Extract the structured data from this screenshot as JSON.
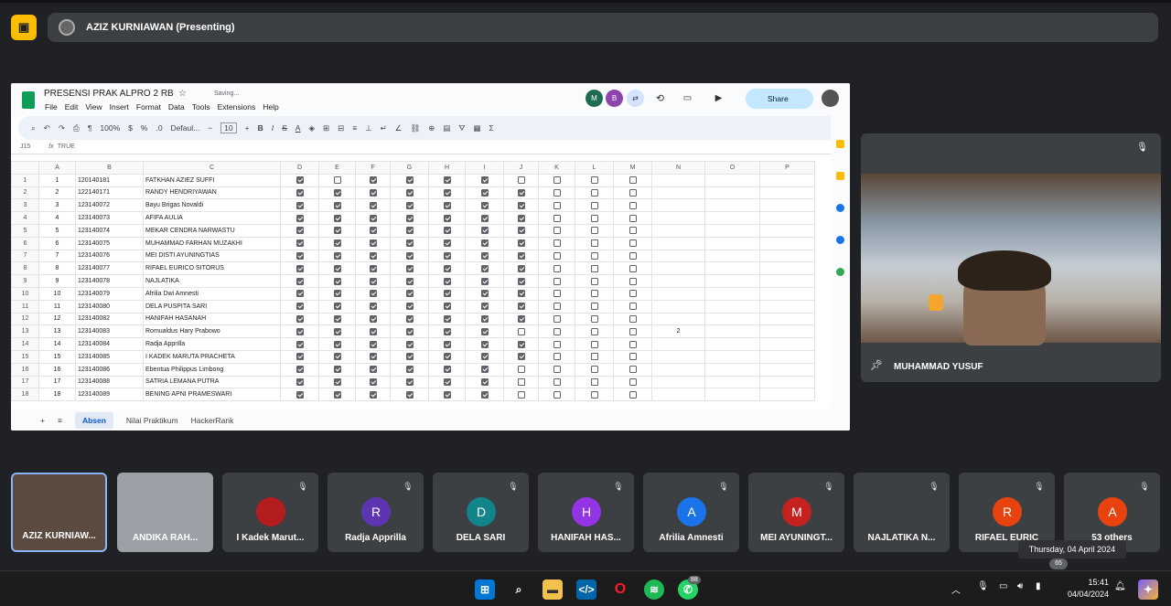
{
  "meet": {
    "presenter_label": "AZIZ KURNIAWAN (Presenting)",
    "video_name": "MUHAMMAD YUSUF"
  },
  "sheet": {
    "title": "PRESENSI PRAK ALPRO 2 RB",
    "saving": "Saving...",
    "menu": [
      "File",
      "Edit",
      "View",
      "Insert",
      "Format",
      "Data",
      "Tools",
      "Extensions",
      "Help"
    ],
    "share_label": "Share",
    "zoom": "100%",
    "font": "Defaul...",
    "font_size": "10",
    "cell_ref": "J15",
    "formula": "TRUE",
    "columns": [
      "",
      "A",
      "B",
      "C",
      "D",
      "E",
      "F",
      "G",
      "H",
      "I",
      "J",
      "K",
      "L",
      "M",
      "N",
      "O",
      "P"
    ],
    "rows": [
      {
        "r": "1",
        "a": "1",
        "b": "120140181",
        "c": "FATKHAN AZIEZ SUFFI",
        "checks": [
          1,
          0,
          1,
          1,
          1,
          1,
          0,
          0,
          0,
          0
        ]
      },
      {
        "r": "2",
        "a": "2",
        "b": "122140171",
        "c": "RANDY HENDRIYAWAN",
        "checks": [
          1,
          1,
          1,
          1,
          1,
          1,
          1,
          0,
          0,
          0
        ]
      },
      {
        "r": "3",
        "a": "3",
        "b": "123140072",
        "c": "Bayu Brigas Novaldi",
        "checks": [
          1,
          1,
          1,
          1,
          1,
          1,
          1,
          0,
          0,
          0
        ]
      },
      {
        "r": "4",
        "a": "4",
        "b": "123140073",
        "c": "AFIFA AULIA",
        "checks": [
          1,
          1,
          1,
          1,
          1,
          1,
          1,
          0,
          0,
          0
        ]
      },
      {
        "r": "5",
        "a": "5",
        "b": "123140074",
        "c": "MEKAR CENDRA NARWASTU",
        "checks": [
          1,
          1,
          1,
          1,
          1,
          1,
          1,
          0,
          0,
          0
        ]
      },
      {
        "r": "6",
        "a": "6",
        "b": "123140075",
        "c": "MUHAMMAD FARHAN MUZAKHI",
        "checks": [
          1,
          1,
          1,
          1,
          1,
          1,
          1,
          0,
          0,
          0
        ]
      },
      {
        "r": "7",
        "a": "7",
        "b": "123140076",
        "c": "MEI DISTI AYUNINGTIAS",
        "checks": [
          1,
          1,
          1,
          1,
          1,
          1,
          1,
          0,
          0,
          0
        ]
      },
      {
        "r": "8",
        "a": "8",
        "b": "123140077",
        "c": "RIFAEL EURICO SITORUS",
        "checks": [
          1,
          1,
          1,
          1,
          1,
          1,
          1,
          0,
          0,
          0
        ]
      },
      {
        "r": "9",
        "a": "9",
        "b": "123140078",
        "c": "NAJLATIKA",
        "checks": [
          1,
          1,
          1,
          1,
          1,
          1,
          1,
          0,
          0,
          0
        ]
      },
      {
        "r": "10",
        "a": "10",
        "b": "123140079",
        "c": "Afrilia Dwi Amnesti",
        "checks": [
          1,
          1,
          1,
          1,
          1,
          1,
          1,
          0,
          0,
          0
        ]
      },
      {
        "r": "11",
        "a": "11",
        "b": "123140080",
        "c": "DELA PUSPITA SARI",
        "checks": [
          1,
          1,
          1,
          1,
          1,
          1,
          1,
          0,
          0,
          0
        ]
      },
      {
        "r": "12",
        "a": "12",
        "b": "123140082",
        "c": "HANIFAH HASANAH",
        "checks": [
          1,
          1,
          1,
          1,
          1,
          1,
          1,
          0,
          0,
          0
        ]
      },
      {
        "r": "13",
        "a": "13",
        "b": "123140083",
        "c": "Romualdus Hary Prabowo",
        "checks": [
          1,
          1,
          1,
          1,
          1,
          1,
          0,
          0,
          0,
          0
        ],
        "n": "2"
      },
      {
        "r": "14",
        "a": "14",
        "b": "123140084",
        "c": "Radja Apprilla",
        "checks": [
          1,
          1,
          1,
          1,
          1,
          1,
          1,
          0,
          0,
          0
        ]
      },
      {
        "r": "15",
        "a": "15",
        "b": "123140085",
        "c": "I KADEK MARUTA PRACHETA",
        "checks": [
          1,
          1,
          1,
          1,
          1,
          1,
          1,
          0,
          0,
          0
        ]
      },
      {
        "r": "16",
        "a": "16",
        "b": "123140086",
        "c": "Ebentua Philippus Limbong",
        "checks": [
          1,
          1,
          1,
          1,
          1,
          1,
          0,
          0,
          0,
          0
        ]
      },
      {
        "r": "17",
        "a": "17",
        "b": "123140088",
        "c": "SATRIA LEMANA PUTRA",
        "checks": [
          1,
          1,
          1,
          1,
          1,
          1,
          0,
          0,
          0,
          0
        ]
      },
      {
        "r": "18",
        "a": "18",
        "b": "123140089",
        "c": "BENING APNI PRAMESWARI",
        "checks": [
          1,
          1,
          1,
          1,
          1,
          1,
          0,
          0,
          0,
          0
        ]
      }
    ],
    "tabs": [
      "Absen",
      "Nilai Praktikum",
      "HackerRank"
    ]
  },
  "participants": [
    {
      "name": "AZIZ KURNIAW...",
      "initial": "",
      "color": "#5a4a40"
    },
    {
      "name": "ANDIKA RAH...",
      "initial": "",
      "color": "#9aa0a6"
    },
    {
      "name": "I Kadek Marut...",
      "initial": "",
      "color": "#b31d1d"
    },
    {
      "name": "Radja Apprilla",
      "initial": "R",
      "color": "#5e35b1"
    },
    {
      "name": "DELA SARI",
      "initial": "D",
      "color": "#12858a"
    },
    {
      "name": "HANIFAH HAS...",
      "initial": "H",
      "color": "#9334e6"
    },
    {
      "name": "Afrilia Amnesti",
      "initial": "A",
      "color": "#1a73e8"
    },
    {
      "name": "MEI AYUNINGT...",
      "initial": "M",
      "color": "#c5221f"
    },
    {
      "name": "NAJLATIKA N...",
      "initial": "",
      "color": "#3c4043"
    },
    {
      "name": "RIFAEL EURIC",
      "initial": "R",
      "color": "#e8430f"
    },
    {
      "name": "53 others",
      "initial": "A",
      "color": "#e8430f"
    }
  ],
  "tooltip": "Thursday, 04 April 2024",
  "badge": "65",
  "taskbar": {
    "time": "15:41",
    "date": "04/04/2024",
    "whatsapp_badge": "88"
  }
}
